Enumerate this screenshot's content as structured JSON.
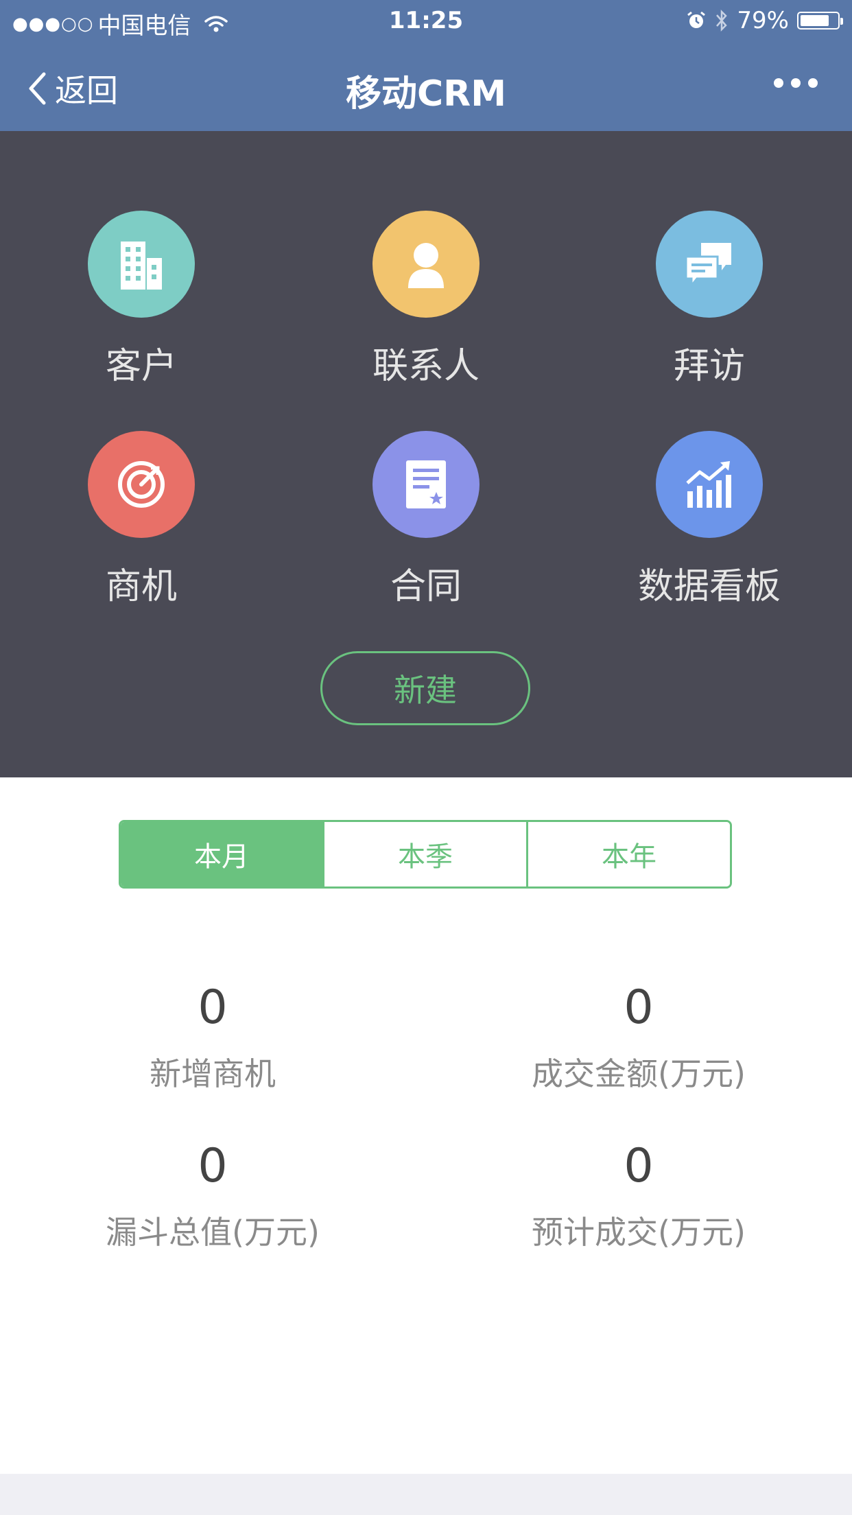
{
  "status_bar": {
    "carrier": "中国电信",
    "time": "11:25",
    "battery_percent": "79%",
    "battery_level": 0.79
  },
  "nav": {
    "back_label": "返回",
    "title": "移动CRM"
  },
  "menu": {
    "items": [
      {
        "label": "客户",
        "icon": "building-icon",
        "color": "#7ecdc5"
      },
      {
        "label": "联系人",
        "icon": "person-icon",
        "color": "#f2c46e"
      },
      {
        "label": "拜访",
        "icon": "chat-bubbles-icon",
        "color": "#7bbde0"
      },
      {
        "label": "商机",
        "icon": "target-icon",
        "color": "#e87068"
      },
      {
        "label": "合同",
        "icon": "contract-icon",
        "color": "#8b92e8"
      },
      {
        "label": "数据看板",
        "icon": "bar-chart-icon",
        "color": "#6c95ea"
      }
    ],
    "new_button": "新建"
  },
  "period_tabs": {
    "selected": "本月",
    "tabs": [
      "本月",
      "本季",
      "本年"
    ]
  },
  "stats": [
    {
      "value": "0",
      "label": "新增商机"
    },
    {
      "value": "0",
      "label": "成交金额(万元)"
    },
    {
      "value": "0",
      "label": "漏斗总值(万元)"
    },
    {
      "value": "0",
      "label": "预计成交(万元)"
    }
  ],
  "colors": {
    "nav_bg": "#5877a8",
    "panel_bg": "#4a4a55",
    "accent_green": "#6ac27f"
  }
}
